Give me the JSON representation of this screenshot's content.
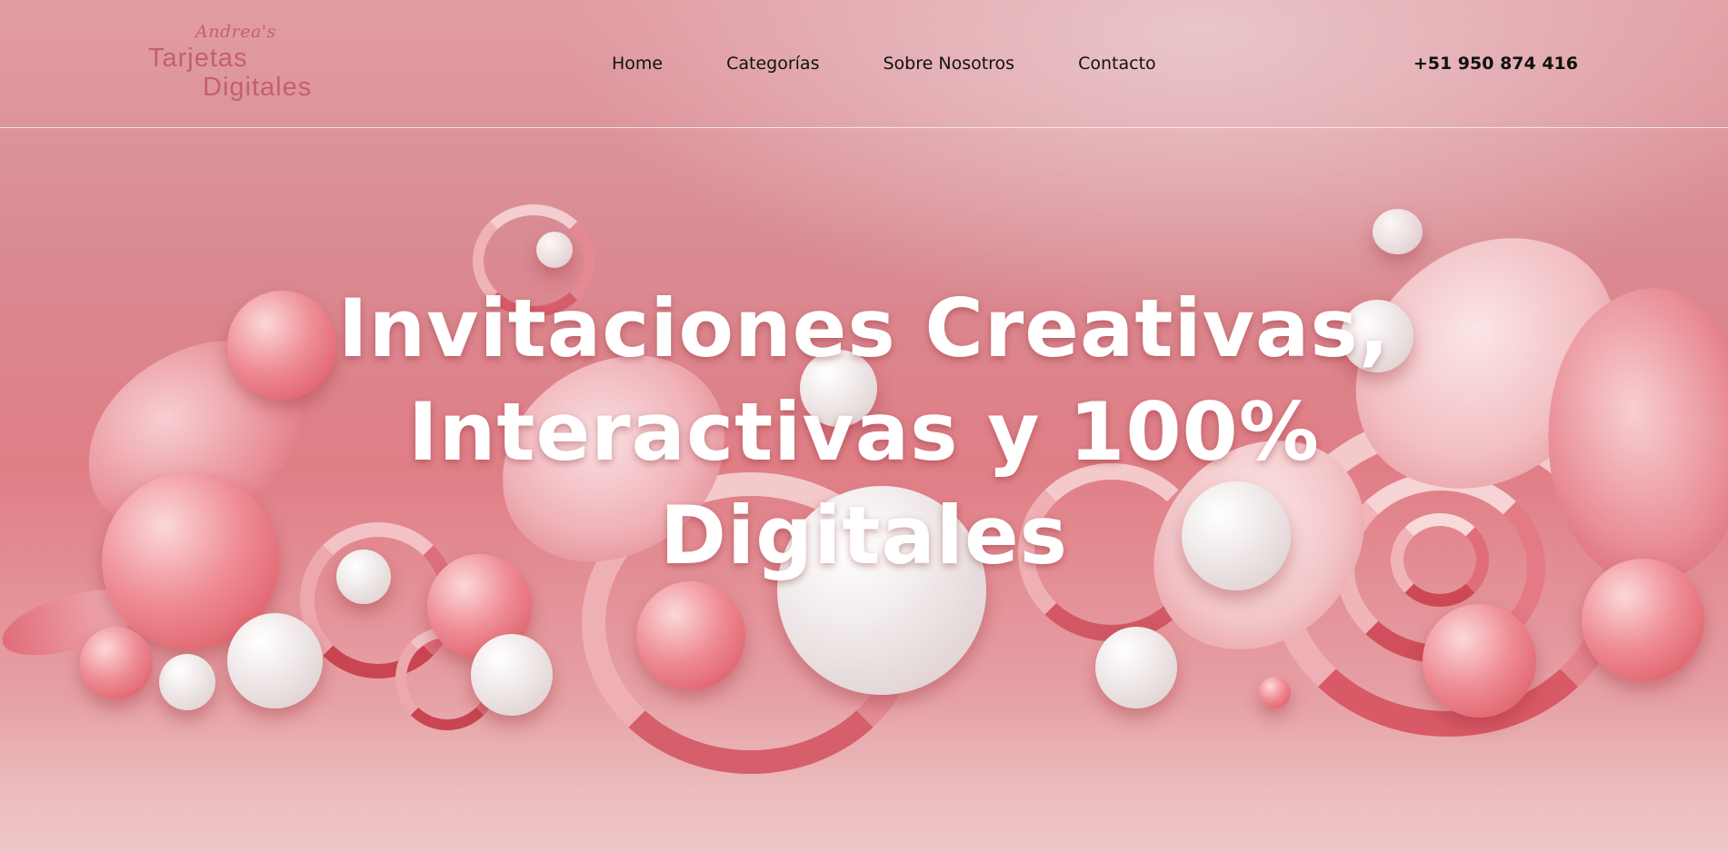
{
  "colors": {
    "background": "#e19aa0",
    "accent": "#c4606c",
    "text_dark": "#111111",
    "hero_text": "#ffffff"
  },
  "logo": {
    "small": "Andrea's",
    "line1": "Tarjetas",
    "line2": "Digitales"
  },
  "nav": {
    "items": [
      {
        "label": "Home"
      },
      {
        "label": "Categorías"
      },
      {
        "label": "Sobre Nosotros"
      },
      {
        "label": "Contacto"
      }
    ]
  },
  "header": {
    "phone": "+51 950 874 416"
  },
  "hero": {
    "line1": "Invitaciones Creativas,",
    "line2": "Interactivas y 100%",
    "line3": "Digitales"
  }
}
